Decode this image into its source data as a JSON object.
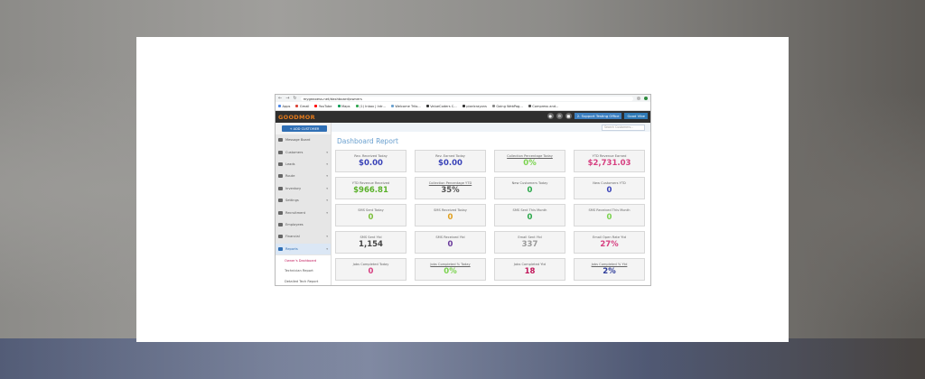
{
  "colors": {
    "blue": "#3a43b8",
    "green": "#5ab12a",
    "pink": "#d63f80",
    "dark": "#555555",
    "gray": "#999999",
    "magenta": "#c2185b",
    "teal": "#2aa84a",
    "navy": "#2f3d9b",
    "accent": "#2f6fb5",
    "logo": "#e57b1c"
  },
  "browser": {
    "url": "mygeaxess.net/dashboard/owners",
    "bookmarks": [
      {
        "label": "Apps",
        "color": "#4a86e8"
      },
      {
        "label": "Gmail",
        "color": "#db4437"
      },
      {
        "label": "YouTube",
        "color": "#ff0000"
      },
      {
        "label": "Maps",
        "color": "#0f9d58"
      },
      {
        "label": "(1) Inbox | Intr...",
        "color": "#34a853"
      },
      {
        "label": "Welcome Trilo...",
        "color": "#6aa0cf"
      },
      {
        "label": "ValueCoders C...",
        "color": "#333333"
      },
      {
        "label": "pixelcrayons",
        "color": "#333333"
      },
      {
        "label": "Going WebPag...",
        "color": "#888888"
      },
      {
        "label": "Compress and...",
        "color": "#555555"
      }
    ]
  },
  "app": {
    "logo": "GOODMOR",
    "office": "2. Support Testing Office",
    "user": "Good Vibe"
  },
  "sidebar": {
    "add_customer": "+ ADD CUSTOMER",
    "items": [
      {
        "label": "Message Board",
        "chevron": false
      },
      {
        "label": "Customers",
        "chevron": true
      },
      {
        "label": "Leads",
        "chevron": true
      },
      {
        "label": "Route",
        "chevron": true
      },
      {
        "label": "Inventory",
        "chevron": true
      },
      {
        "label": "Settings",
        "chevron": true
      },
      {
        "label": "Recruitment",
        "chevron": true
      },
      {
        "label": "Employees",
        "chevron": false
      },
      {
        "label": "Financial",
        "chevron": true
      },
      {
        "label": "Reports",
        "chevron": true
      }
    ],
    "sub_items": [
      "Owner's Dashboard",
      "Technician Report",
      "Detailed Tech Report"
    ]
  },
  "main": {
    "search_placeholder": "Search Customers...",
    "title": "Dashboard Report",
    "cards": [
      {
        "label": "Rev. Received Today",
        "value": "$0.00",
        "color": "#3a43b8",
        "underline": false
      },
      {
        "label": "Rev. Earned Today",
        "value": "$0.00",
        "color": "#3a43b8",
        "underline": false
      },
      {
        "label": "Collection Percentage Today",
        "value": "0%",
        "color": "#7bd34f",
        "underline": true
      },
      {
        "label": "YTD Revenue Earned",
        "value": "$2,731.03",
        "color": "#d63f80",
        "underline": false
      },
      {
        "label": "YTD Revenue Received",
        "value": "$966.81",
        "color": "#5ab12a",
        "underline": false
      },
      {
        "label": "Collection Percentage YTD",
        "value": "35%",
        "color": "#555555",
        "underline": true
      },
      {
        "label": "New Customers Today",
        "value": "0",
        "color": "#2aa84a",
        "underline": false
      },
      {
        "label": "New Customers YTD",
        "value": "0",
        "color": "#3a43b8",
        "underline": false
      },
      {
        "label": "SMS Sent Today",
        "value": "0",
        "color": "#7bbf3a",
        "underline": false
      },
      {
        "label": "SMS Received Today",
        "value": "0",
        "color": "#e0a020",
        "underline": false
      },
      {
        "label": "SMS Sent This Month",
        "value": "0",
        "color": "#2aa84a",
        "underline": false
      },
      {
        "label": "SMS Received This Month",
        "value": "0",
        "color": "#7bd34f",
        "underline": false
      },
      {
        "label": "SMS Sent Ytd",
        "value": "1,154",
        "color": "#444444",
        "underline": false
      },
      {
        "label": "SMS Received Ytd",
        "value": "0",
        "color": "#6a3a9b",
        "underline": false
      },
      {
        "label": "Email Sent Ytd",
        "value": "337",
        "color": "#999999",
        "underline": false
      },
      {
        "label": "Email Open Rate Ytd",
        "value": "27%",
        "color": "#d63f80",
        "underline": false
      },
      {
        "label": "Jobs Completed Today",
        "value": "0",
        "color": "#d63f80",
        "underline": false
      },
      {
        "label": "Jobs Completed % Today",
        "value": "0%",
        "color": "#7bd34f",
        "underline": true
      },
      {
        "label": "Jobs Completed Ytd",
        "value": "18",
        "color": "#c2185b",
        "underline": false
      },
      {
        "label": "Jobs Completed % Ytd",
        "value": "2%",
        "color": "#2f3d9b",
        "underline": true
      }
    ]
  }
}
